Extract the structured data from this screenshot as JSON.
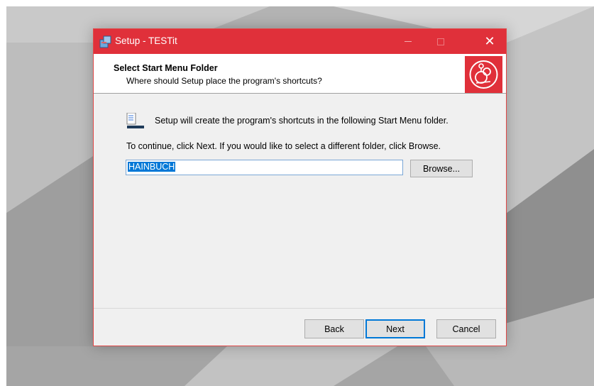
{
  "window": {
    "title": "Setup - TESTit",
    "accent_color": "#e0303a",
    "controls": {
      "minimize": "—",
      "maximize": "□",
      "close": "✕"
    }
  },
  "header": {
    "title": "Select Start Menu Folder",
    "subtitle": "Where should Setup place the program's shortcuts?",
    "logo_icon": "testit-logo-icon"
  },
  "content": {
    "info_text": "Setup will create the program's shortcuts in the following Start Menu folder.",
    "continue_text": "To continue, click Next. If you would like to select a different folder, click Browse.",
    "folder_value": "HAINBUCH",
    "browse_label": "Browse..."
  },
  "footer": {
    "back_label": "Back",
    "next_label": "Next",
    "cancel_label": "Cancel"
  }
}
